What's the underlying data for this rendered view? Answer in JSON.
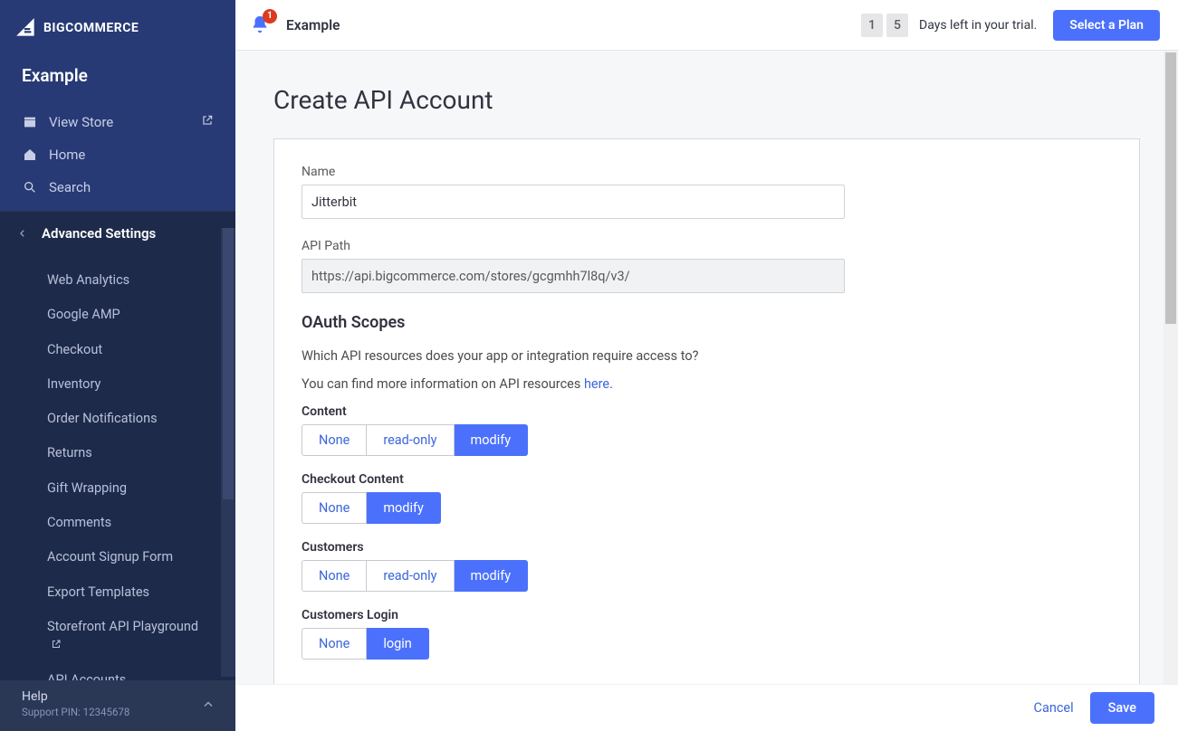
{
  "brand": "BIGCOMMERCE",
  "store_name": "Example",
  "topnav": {
    "view_store": "View Store",
    "home": "Home",
    "search": "Search"
  },
  "section": {
    "title": "Advanced Settings"
  },
  "subnav": [
    "Web Analytics",
    "Google AMP",
    "Checkout",
    "Inventory",
    "Order Notifications",
    "Returns",
    "Gift Wrapping",
    "Comments",
    "Account Signup Form",
    "Export Templates",
    "Storefront API Playground",
    "API Accounts"
  ],
  "footer": {
    "help": "Help",
    "pin": "Support PIN: 12345678"
  },
  "topbar": {
    "store": "Example",
    "badge": "1",
    "trial_digits": [
      "1",
      "5"
    ],
    "trial_text": "Days left in your trial.",
    "plan_btn": "Select a Plan"
  },
  "page": {
    "title": "Create API Account",
    "name_label": "Name",
    "name_value": "Jitterbit",
    "apipath_label": "API Path",
    "apipath_value": "https://api.bigcommerce.com/stores/gcgmhh7l8q/v3/",
    "oauth_title": "OAuth Scopes",
    "helper1": "Which API resources does your app or integration require access to?",
    "helper2_prefix": "You can find more information on API resources ",
    "helper2_link": "here",
    "helper2_suffix": "."
  },
  "scopes": [
    {
      "label": "Content",
      "options": [
        "None",
        "read-only",
        "modify"
      ],
      "selected": 2
    },
    {
      "label": "Checkout Content",
      "options": [
        "None",
        "modify"
      ],
      "selected": 1
    },
    {
      "label": "Customers",
      "options": [
        "None",
        "read-only",
        "modify"
      ],
      "selected": 2
    },
    {
      "label": "Customers Login",
      "options": [
        "None",
        "login"
      ],
      "selected": 1
    }
  ],
  "actions": {
    "cancel": "Cancel",
    "save": "Save"
  }
}
